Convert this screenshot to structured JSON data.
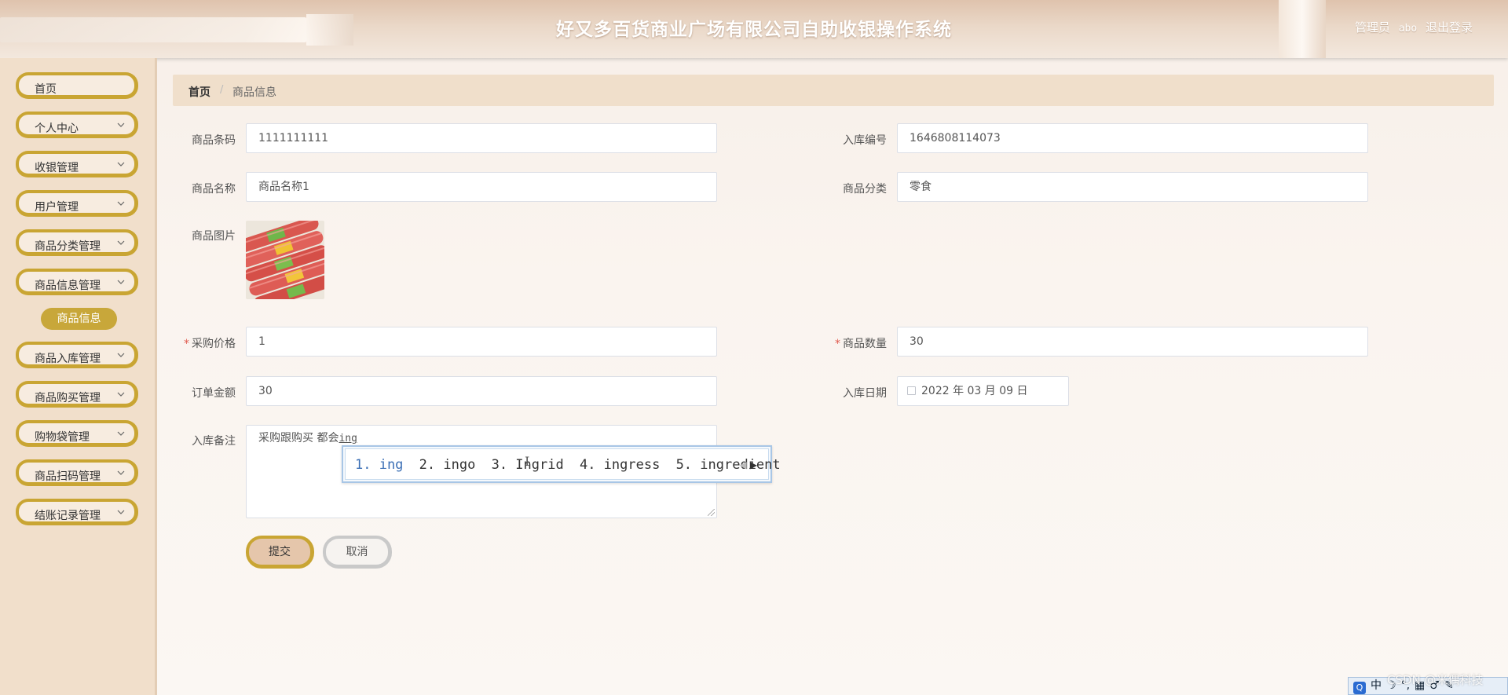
{
  "header": {
    "title": "好又多百货商业广场有限公司自助收银操作系统",
    "role": "管理员",
    "username": "abo",
    "logout_label": "退出登录"
  },
  "sidebar": {
    "items": [
      {
        "label": "首页",
        "has_arrow": false
      },
      {
        "label": "个人中心",
        "has_arrow": true
      },
      {
        "label": "收银管理",
        "has_arrow": true
      },
      {
        "label": "用户管理",
        "has_arrow": true
      },
      {
        "label": "商品分类管理",
        "has_arrow": true
      },
      {
        "label": "商品信息管理",
        "has_arrow": true
      },
      {
        "label": "商品入库管理",
        "has_arrow": true
      },
      {
        "label": "商品购买管理",
        "has_arrow": true
      },
      {
        "label": "购物袋管理",
        "has_arrow": true
      },
      {
        "label": "商品扫码管理",
        "has_arrow": true
      },
      {
        "label": "结账记录管理",
        "has_arrow": true
      }
    ],
    "active_sub": "商品信息"
  },
  "breadcrumb": {
    "home": "首页",
    "separator": "/",
    "current": "商品信息"
  },
  "form": {
    "barcode": {
      "label": "商品条码",
      "value": "1111111111"
    },
    "stock_no": {
      "label": "入库编号",
      "value": "1646808114073"
    },
    "name": {
      "label": "商品名称",
      "value": "商品名称1"
    },
    "category": {
      "label": "商品分类",
      "value": "零食"
    },
    "image": {
      "label": "商品图片"
    },
    "purchase_price": {
      "label": "采购价格",
      "value": "1",
      "required": "*"
    },
    "quantity": {
      "label": "商品数量",
      "value": "30",
      "required": "*"
    },
    "order_amount": {
      "label": "订单金额",
      "value": "30"
    },
    "stock_date": {
      "label": "入库日期",
      "value": "2022 年 03 月 09 日"
    },
    "remark": {
      "label": "入库备注",
      "value": "采购跟购买  都会",
      "composing": "ing"
    },
    "submit_label": "提交",
    "cancel_label": "取消"
  },
  "ime": {
    "candidates": [
      "1. ing",
      "2. ingo",
      "3. Ingrid",
      "4. ingress",
      "5. ingredient"
    ],
    "prev": "◀",
    "next": "▶"
  },
  "watermark": "CSDN @米偶科技",
  "ime_toolbar": {
    "logo": "Q",
    "mode": "中",
    "items": [
      "☽",
      "°,",
      "▦",
      "♂",
      "✎"
    ]
  },
  "colors": {
    "accent_gold": "#c9a533",
    "sidebar_bg": "#f1dfcb",
    "breadcrumb_bg": "#f0dfcb",
    "required": "#e05a4f"
  }
}
